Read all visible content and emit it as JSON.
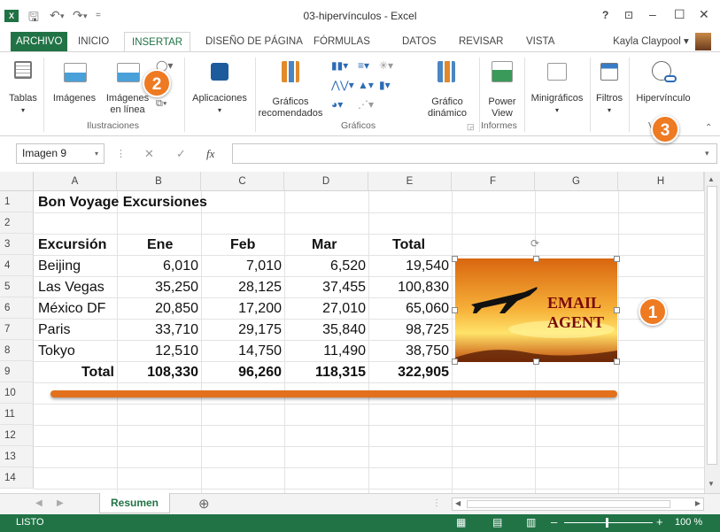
{
  "titlebar": {
    "title": "03-hipervínculos - Excel",
    "app_icon": "X",
    "help": "?"
  },
  "tabs": [
    "ARCHIVO",
    "INICIO",
    "INSERTAR",
    "DISEÑO DE PÁGINA",
    "FÓRMULAS",
    "DATOS",
    "REVISAR",
    "VISTA"
  ],
  "active_tab": "INSERTAR",
  "user": "Kayla Claypool",
  "ribbon": {
    "tablas": "Tablas",
    "imagenes": "Imágenes",
    "imagenes_en_linea_1": "Imágenes",
    "imagenes_en_linea_2": "en línea",
    "aplicaciones": "Aplicaciones",
    "graficos_rec_1": "Gráficos",
    "graficos_rec_2": "recomendados",
    "grafico_din_1": "Gráfico",
    "grafico_din_2": "dinámico",
    "power_view_1": "Power",
    "power_view_2": "View",
    "minigraficos": "Minigráficos",
    "filtros": "Filtros",
    "hipervinculo": "Hipervínculo",
    "group_ilustraciones": "Ilustraciones",
    "group_graficos": "Gráficos",
    "group_informes": "Informes",
    "group_vinculos": "V"
  },
  "formula_bar": {
    "name_box": "Imagen 9",
    "fx": "fx",
    "value": ""
  },
  "columns": [
    "A",
    "B",
    "C",
    "D",
    "E",
    "F",
    "G",
    "H"
  ],
  "rows": [
    "1",
    "2",
    "3",
    "4",
    "5",
    "6",
    "7",
    "8",
    "9",
    "10",
    "11",
    "12",
    "13",
    "14"
  ],
  "sheet": {
    "title": "Bon Voyage Excursiones",
    "headers": [
      "Excursión",
      "Ene",
      "Feb",
      "Mar",
      "Total"
    ],
    "data": [
      [
        "Beijing",
        "6,010",
        "7,010",
        "6,520",
        "19,540"
      ],
      [
        "Las Vegas",
        "35,250",
        "28,125",
        "37,455",
        "100,830"
      ],
      [
        "México DF",
        "20,850",
        "17,200",
        "27,010",
        "65,060"
      ],
      [
        "Paris",
        "33,710",
        "29,175",
        "35,840",
        "98,725"
      ],
      [
        "Tokyo",
        "12,510",
        "14,750",
        "11,490",
        "38,750"
      ]
    ],
    "totals": [
      "Total",
      "108,330",
      "96,260",
      "118,315",
      "322,905"
    ]
  },
  "image": {
    "line1": "EMAIL",
    "line2": "AGENT"
  },
  "badges": [
    "2",
    "3",
    "1"
  ],
  "sheet_tabs": {
    "active": "Resumen",
    "add": "⊕"
  },
  "status": {
    "mode": "LISTO",
    "zoom": "100 %"
  },
  "colors": {
    "excel_green": "#217346",
    "badge_orange": "#ee7a22",
    "bar_orange": "#e2701d"
  }
}
